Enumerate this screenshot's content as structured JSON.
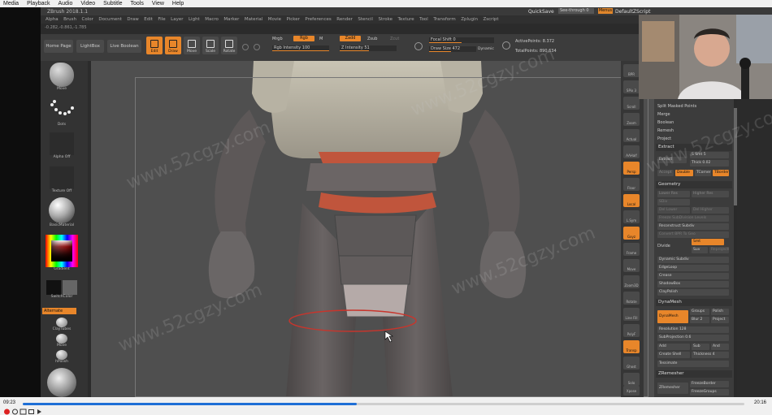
{
  "player": {
    "menu": [
      "Media",
      "Playback",
      "Audio",
      "Video",
      "Subtitle",
      "Tools",
      "View",
      "Help"
    ],
    "time_elapsed": "09:23",
    "time_total": "20:16",
    "progress": 0.463
  },
  "zbrush": {
    "title": "ZBrush 2018.1.1",
    "quicksave": "QuickSave",
    "see_through": "See-through 0",
    "menus_btn": "Menus",
    "default_script": "DefaultZScript",
    "menu": [
      "Alpha",
      "Brush",
      "Color",
      "Document",
      "Draw",
      "Edit",
      "File",
      "Layer",
      "Light",
      "Macro",
      "Marker",
      "Material",
      "Movie",
      "Picker",
      "Preferences",
      "Render",
      "Stencil",
      "Stroke",
      "Texture",
      "Tool",
      "Transform",
      "Zplugin",
      "Zscript"
    ],
    "coords": "-0.282,-0.861,-1.785",
    "shelf": {
      "home_page": "Home Page",
      "lightbox": "LightBox",
      "live_boolean": "Live Boolean",
      "edit": "Edit",
      "draw": "Draw",
      "move": "Move",
      "scale": "Scale",
      "rotate": "Rotate",
      "mrgb": "Mrgb",
      "rgb": "Rgb",
      "m": "M",
      "zadd": "Zadd",
      "zsub": "Zsub",
      "zcut": "Zcut",
      "rgb_intensity": "Rgb Intensity 100",
      "z_intensity": "Z Intensity 51",
      "focal_shift": "Focal Shift 0",
      "draw_size": "Draw Size 472",
      "dynamic": "Dynamic",
      "active_points": "ActivePoints: 8.372",
      "total_points": "TotalPoints: 890,634"
    },
    "left_tray": {
      "brush": "Move",
      "stroke": "Dots",
      "alpha": "Alpha Off",
      "texture": "Texture Off",
      "material": "BasicMaterial",
      "gradient": "Gradient",
      "switch_color": "SwitchColor",
      "alternate": "Alternate",
      "lower_brushes": [
        "ClayTubes",
        "Move",
        "hPolish"
      ]
    },
    "right_shelf": [
      "BPR",
      "SPix 3",
      "Scroll",
      "Zoom",
      "Actual",
      "AAHalf",
      "Persp",
      "Floor",
      "Local",
      "L.Sym",
      "Gxyz",
      "Frame",
      "Move",
      "Zoom3D",
      "Rotate",
      "Line Fill",
      "PolyF",
      "Transp",
      "Ghost",
      "Solo",
      "Xpose"
    ],
    "subtool_panel": {
      "items": [
        "Split Masked Points",
        "Merge",
        "Boolean",
        "Remesh",
        "Project"
      ],
      "extract": "Extract",
      "extract_btn": "Extract",
      "s_smt": "S Smt 5",
      "thick": "Thick 0.02",
      "accept": "Accept",
      "double": "Double",
      "tcorner": "TCorner",
      "tborder": "TBorder",
      "geometry": "Geometry",
      "lower_res": "Lower Res",
      "higher_res": "Higher Res",
      "sdiv": "SDiv",
      "del_lower": "Del Lower",
      "del_higher": "Del Higher",
      "freeze": "Freeze SubDivision Levels",
      "reconstruct": "Reconstruct Subdiv",
      "convert_bpr": "Convert BPR To Geo",
      "divide": "Divide",
      "smt": "Smt",
      "suv": "Suv",
      "rsmt": "ReprojectHigherSubdiv",
      "dynamic_subdiv": "Dynamic Subdiv",
      "edgeloop": "EdgeLoop",
      "crease": "Crease",
      "shadowbox": "ShadowBox",
      "claypolish": "ClayPolish",
      "dynamesh_head": "DynaMesh",
      "dynamesh": "DynaMesh",
      "groups": "Groups",
      "polish": "Polish",
      "blur": "Blur 2",
      "project": "Project",
      "resolution": "Resolution 128",
      "subprojection": "SubProjection 0.6",
      "add": "Add",
      "sub": "Sub",
      "and": "And",
      "create_shell": "Create Shell",
      "thickness": "Thickness 4",
      "tessimate": "Tessimate",
      "zremesher_head": "ZRemesher",
      "zremesher": "ZRemesher",
      "freeze_border": "FreezeBorder",
      "freeze_groups": "FreezeGroups"
    }
  },
  "watermark": "www.52cgzy.com",
  "colors": {
    "accent": "#e8862a",
    "seek": "#1f6fd6",
    "band": "#c0553c"
  }
}
